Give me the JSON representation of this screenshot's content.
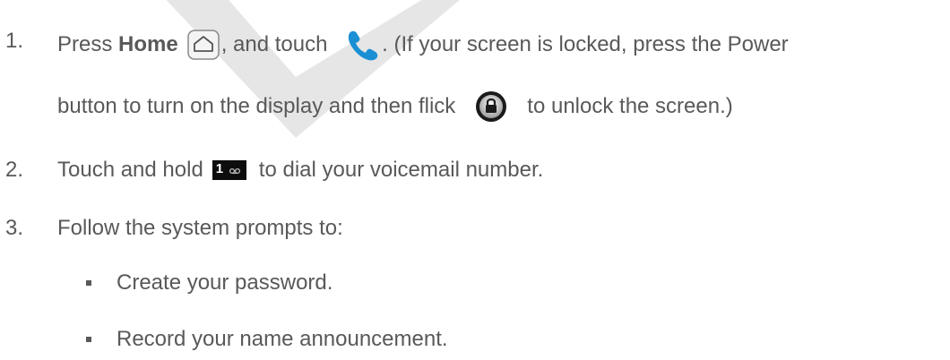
{
  "steps": [
    {
      "number": "1.",
      "prefix": "Press ",
      "bold": "Home",
      "mid": ", and touch ",
      "after_phone": ". (If your screen is locked, press the Power",
      "line2_before": "button to turn on the display and then flick",
      "line2_after": "to unlock the screen.)"
    },
    {
      "number": "2.",
      "before": "Touch and hold",
      "key_label": "1",
      "after": "to dial your voicemail number."
    },
    {
      "number": "3.",
      "text": "Follow the system prompts to:"
    }
  ],
  "bullets": [
    "Create your password.",
    "Record your name announcement."
  ],
  "icons": {
    "home": "home-key-icon",
    "phone": "phone-icon",
    "lock": "lock-icon",
    "key1": "voicemail-key-icon"
  },
  "colors": {
    "text": "#595959",
    "phone": "#1a8fd4",
    "watermark": "#e2e2e2"
  }
}
